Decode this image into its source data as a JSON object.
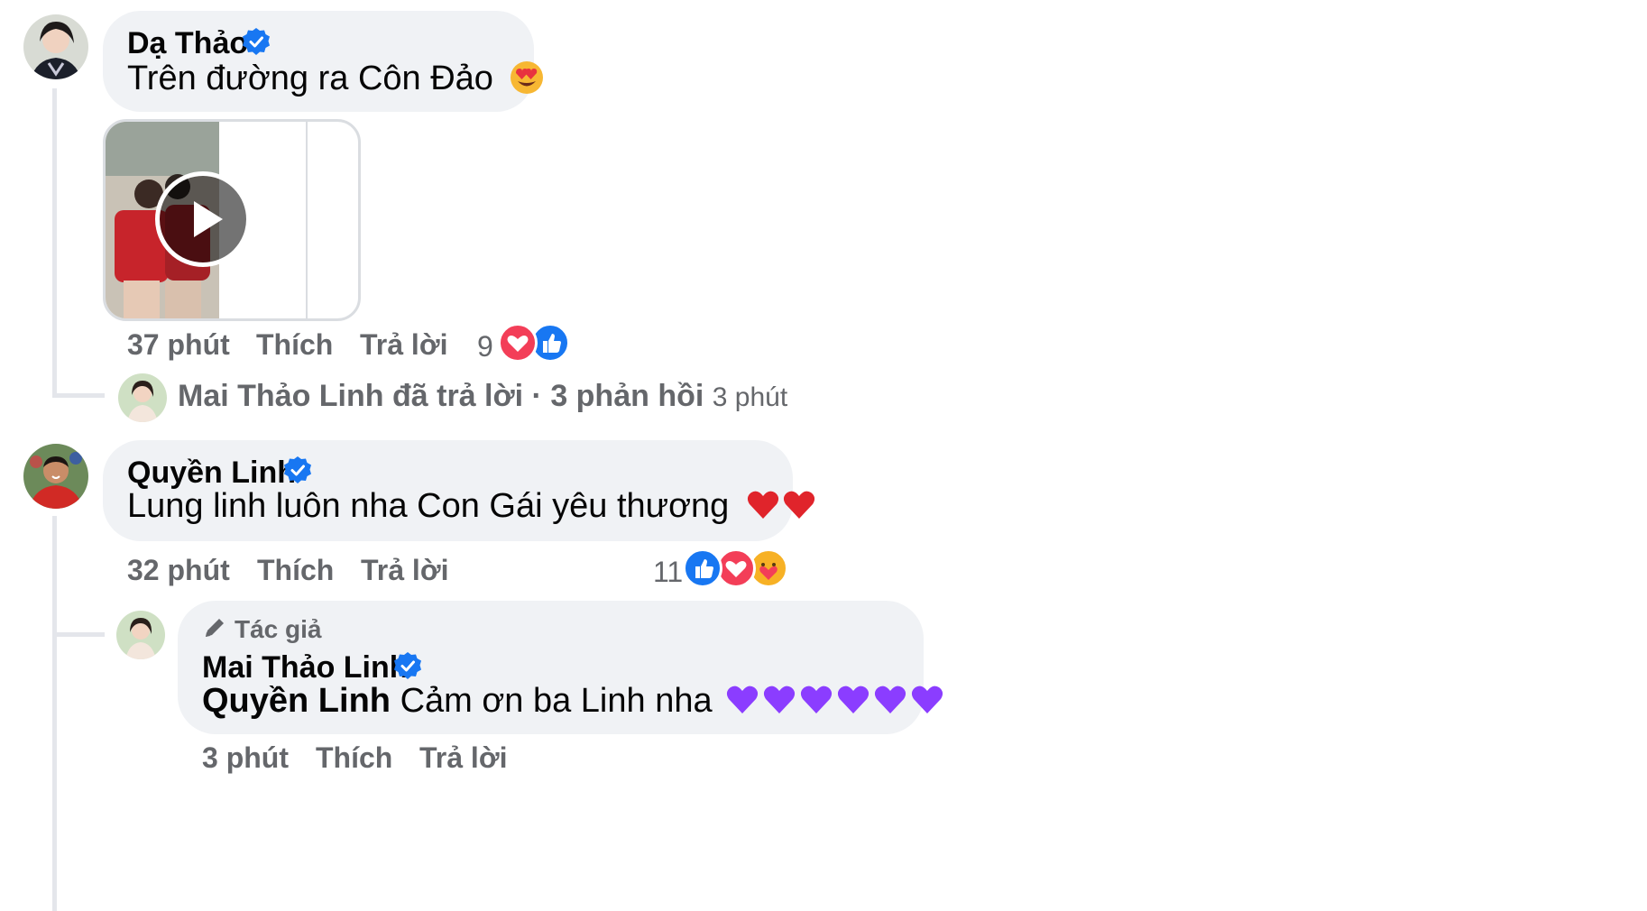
{
  "comments": [
    {
      "author": "Dạ Thảo",
      "text": "Trên đường ra Côn Đảo",
      "time": "37 phút",
      "like": "Thích",
      "reply": "Trả lời",
      "reaction_count": "9",
      "reactions": [
        "heart-reaction",
        "like-reaction"
      ],
      "avatar_icon": "avatar-da-thao",
      "text_emoji": "heart-eyes-emoji"
    },
    {
      "author": "Quyền Linh",
      "text": "Lung linh luôn nha Con Gái yêu thương",
      "time": "32 phút",
      "like": "Thích",
      "reply": "Trả lời",
      "reaction_count": "11",
      "reactions": [
        "like-reaction",
        "heart-reaction",
        "care-reaction"
      ],
      "avatar_icon": "avatar-quyen-linh",
      "text_emoji": "red-heart-emoji x2"
    }
  ],
  "reply_summary": {
    "author": "Mai Thảo Linh",
    "text": "đã trả lời · 3 phản hồi",
    "time": "3 phút"
  },
  "author_reply": {
    "badge": "Tác giả",
    "author": "Mai Thảo Linh",
    "mention": "Quyền Linh",
    "text": "Cảm ơn ba Linh nha",
    "time": "3 phút",
    "like": "Thích",
    "reply": "Trả lời",
    "text_emoji": "purple-heart-emoji x6"
  },
  "colors": {
    "bubble": "#f0f2f5",
    "meta": "#65676b",
    "verified": "#1877f2",
    "heart": "#f33e58",
    "like": "#1877f2",
    "purple_heart": "#8b3dff"
  }
}
